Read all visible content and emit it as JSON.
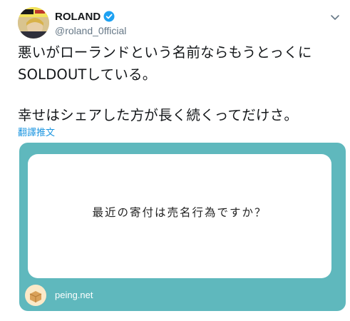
{
  "author": {
    "display_name": "ROLAND",
    "handle": "@roland_0fficial",
    "verified": true
  },
  "tweet": {
    "lines": [
      "悪いがローランドという名前ならもうとっくに",
      "SOLDOUTしている。",
      "幸せはシェアした方が長く続くってだけさ。"
    ],
    "translate_label": "翻譯推文"
  },
  "card": {
    "question": "最近の寄付は売名行為ですか？",
    "domain": "peing.net",
    "background_color": "#5fb8bd"
  },
  "icons": {
    "verified": "verified-badge-icon",
    "caret": "chevron-down-icon",
    "peing": "peing-box-logo-icon"
  }
}
